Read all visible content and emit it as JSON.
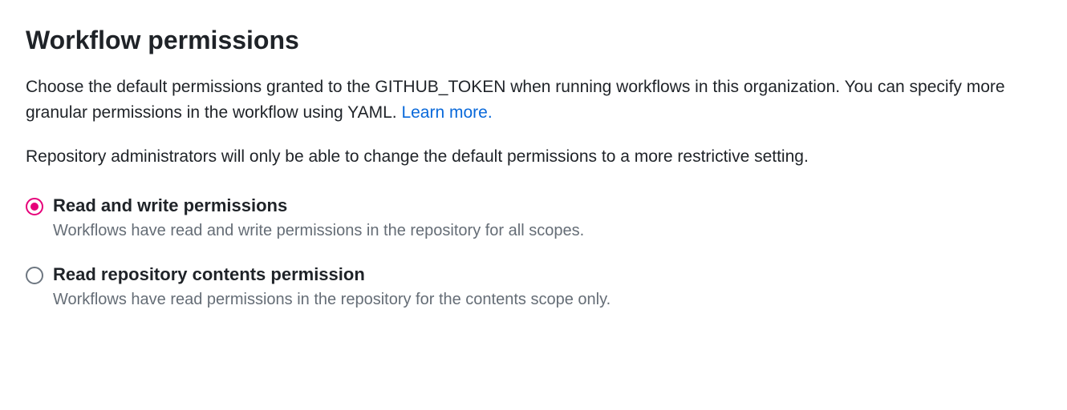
{
  "heading": "Workflow permissions",
  "description_part1": "Choose the default permissions granted to the GITHUB_TOKEN when running workflows in this organization. You can specify more granular permissions in the workflow using YAML. ",
  "learn_more_link": "Learn more.",
  "note": "Repository administrators will only be able to change the default permissions to a more restrictive setting.",
  "options": [
    {
      "label": "Read and write permissions",
      "description": "Workflows have read and write permissions in the repository for all scopes.",
      "selected": true
    },
    {
      "label": "Read repository contents permission",
      "description": "Workflows have read permissions in the repository for the contents scope only.",
      "selected": false
    }
  ]
}
